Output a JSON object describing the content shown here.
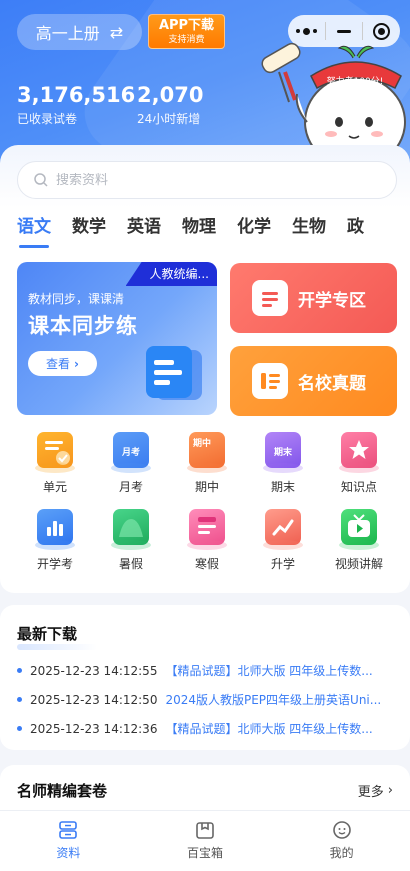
{
  "header": {
    "grade": "高一上册",
    "app_download": "APP下载",
    "app_download_sub": "支持消费",
    "mascot_banner": "努力考100分!",
    "stats": [
      {
        "value": "3,176,516",
        "label": "已收录试卷"
      },
      {
        "value": "2,070",
        "label": "24小时新增"
      }
    ]
  },
  "search": {
    "placeholder": "搜索资料"
  },
  "subjects": [
    "语文",
    "数学",
    "英语",
    "物理",
    "化学",
    "生物",
    "政"
  ],
  "banner": {
    "tag": "人教统编...",
    "subtitle": "教材同步，课课清",
    "title": "课本同步练",
    "button": "查看"
  },
  "side_cards": [
    {
      "label": "开学专区"
    },
    {
      "label": "名校真题"
    }
  ],
  "grid": [
    {
      "label": "单元",
      "icon": "unit-icon",
      "color": "#f7a21b"
    },
    {
      "label": "月考",
      "icon": "monthly-exam-icon",
      "color": "#4a8ef5",
      "text": "月考"
    },
    {
      "label": "期中",
      "icon": "midterm-icon",
      "color": "#f77d3e",
      "text": "期中"
    },
    {
      "label": "期末",
      "icon": "final-exam-icon",
      "color": "#9b6af2",
      "text": "期末"
    },
    {
      "label": "知识点",
      "icon": "knowledge-icon",
      "color": "#f2608a"
    },
    {
      "label": "开学考",
      "icon": "entrance-exam-icon",
      "color": "#3f86f5"
    },
    {
      "label": "暑假",
      "icon": "summer-icon",
      "color": "#2cc06e"
    },
    {
      "label": "寒假",
      "icon": "winter-icon",
      "color": "#f5669a"
    },
    {
      "label": "升学",
      "icon": "promotion-icon",
      "color": "#f67a6a"
    },
    {
      "label": "视频讲解",
      "icon": "video-icon",
      "color": "#2dc75f"
    }
  ],
  "latest": {
    "title": "最新下载",
    "items": [
      {
        "time": "2025-12-23 14:12:55",
        "title": "【精品试题】北师大版 四年级上传数..."
      },
      {
        "time": "2025-12-23 14:12:50",
        "title": "2024版人教版PEP四年级上册英语Uni..."
      },
      {
        "time": "2025-12-23 14:12:36",
        "title": "【精品试题】北师大版 四年级上传数..."
      }
    ]
  },
  "teachers": {
    "title": "名师精编套卷",
    "more": "更多"
  },
  "tabbar": [
    {
      "label": "资料",
      "icon": "materials-icon",
      "active": true
    },
    {
      "label": "百宝箱",
      "icon": "toolbox-icon",
      "active": false
    },
    {
      "label": "我的",
      "icon": "profile-icon",
      "active": false
    }
  ],
  "colors": {
    "accent": "#3a7cf5",
    "orange": "#ff8a00",
    "red": "#f45a55"
  }
}
